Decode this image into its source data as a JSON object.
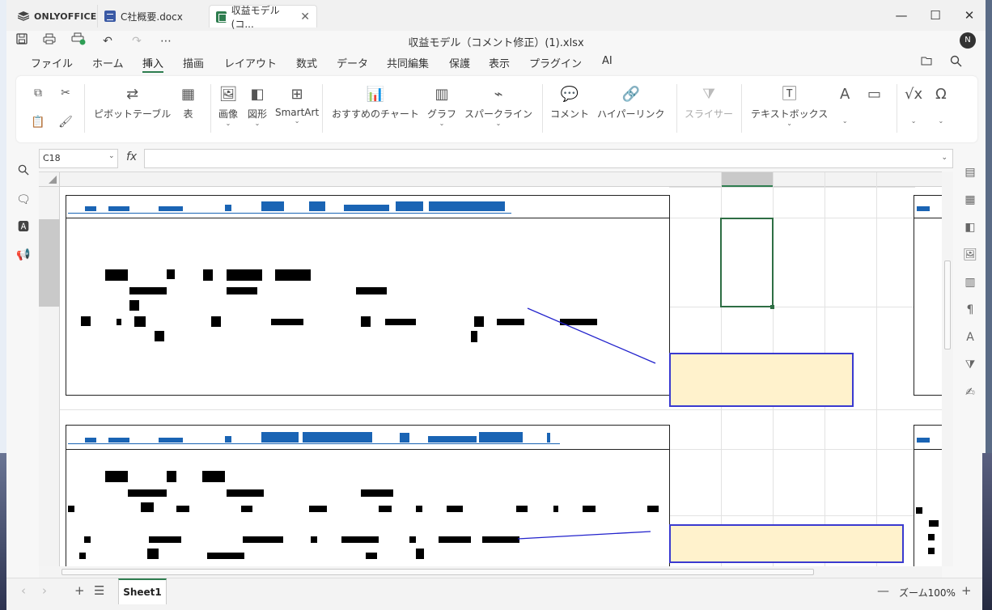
{
  "tabs": [
    {
      "label": "ONLYOFFICE"
    },
    {
      "label": "C社概要.docx"
    },
    {
      "label": "収益モデル(コ..."
    }
  ],
  "window_controls": {
    "minimize": "—",
    "maximize": "☐",
    "close": "✕"
  },
  "doc_title": "収益モデル（コメント修正）(1).xlsx",
  "avatar_initial": "N",
  "menu": [
    {
      "label": "ファイル"
    },
    {
      "label": "ホーム"
    },
    {
      "label": "挿入"
    },
    {
      "label": "描画"
    },
    {
      "label": "レイアウト"
    },
    {
      "label": "数式"
    },
    {
      "label": "データ"
    },
    {
      "label": "共同編集"
    },
    {
      "label": "保護"
    },
    {
      "label": "表示"
    },
    {
      "label": "プラグイン"
    },
    {
      "label": "AI"
    }
  ],
  "active_menu": "挿入",
  "ribbon": {
    "pivot": "ピボットテーブル",
    "table": "表",
    "image": "画像",
    "shape": "図形",
    "smartart": "SmartArt",
    "recommended_chart": "おすすめのチャート",
    "chart": "グラフ",
    "sparkline": "スパークライン",
    "comment": "コメント",
    "hyperlink": "ハイパーリンク",
    "slicer": "スライサー",
    "textbox": "テキストボックス"
  },
  "formula_bar": {
    "cell_ref": "C18",
    "fx": "fx",
    "formula": ""
  },
  "sheet_tab": "Sheet1",
  "zoom": "ズーム100%",
  "colors": {
    "accent_green": "#2e7d4f",
    "redaction_blue": "#1a64b4",
    "callout_fill": "#fff2cc",
    "callout_border": "#3a3ad0"
  }
}
